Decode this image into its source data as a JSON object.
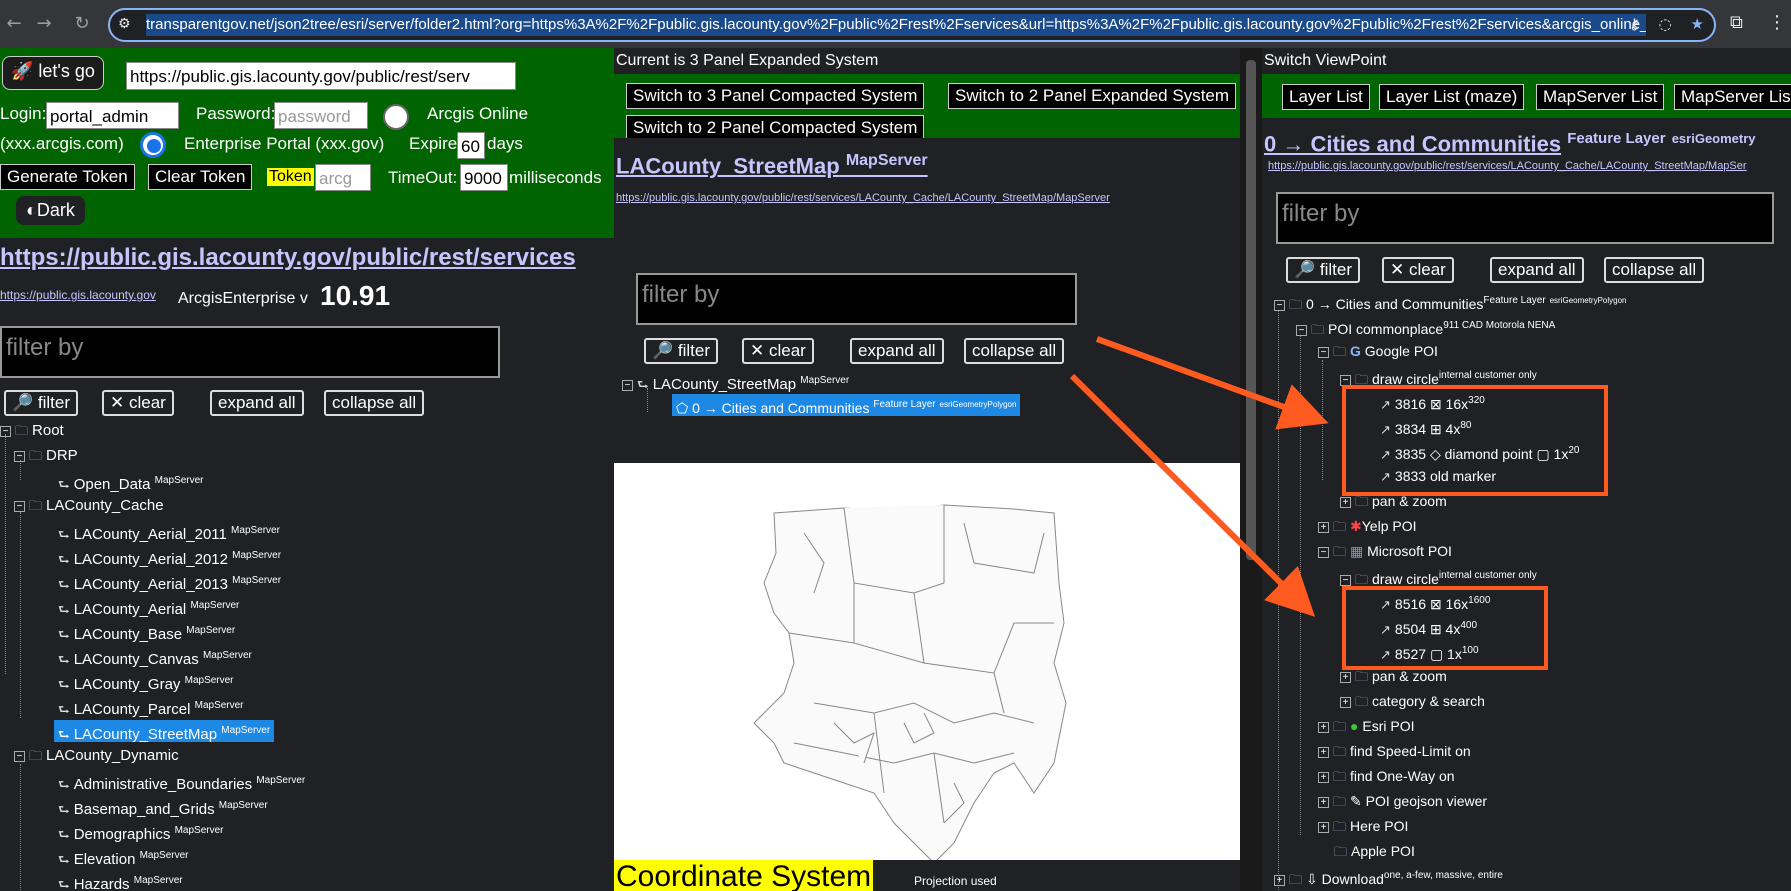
{
  "browser": {
    "url": "transparentgov.net/json2tree/esri/server/folder2.html?org=https%3A%2F%2Fpublic.gis.lacounty.gov%2Fpublic%2Frest%2Fservices&url=https%3A%2F%2Fpublic.gis.lacounty.gov%2Fpublic%2Frest%2Fservices&arcgis_online_token=&timeo"
  },
  "left": {
    "lets_go": "🚀 let's go",
    "url_value": "https://public.gis.lacounty.gov/public/rest/serv",
    "login_label": "Login:",
    "login_value": "portal_admin",
    "password_label": "Password:",
    "password_placeholder": "password",
    "arcgis_online_label": "Arcgis Online",
    "arcgis_online_sub": "(xxx.arcgis.com)",
    "enterprise_label": "Enterprise Portal (xxx.gov)",
    "expire_label": "Expire",
    "expire_value": "60",
    "days_label": "days",
    "generate_token": "Generate Token",
    "clear_token": "Clear Token",
    "token_label": "Token",
    "token_placeholder": "arcg",
    "timeout_label": "TimeOut:",
    "timeout_value": "9000",
    "ms_label": "milliseconds",
    "dark_label": "◐Dark",
    "services_link": "https://public.gis.lacounty.gov/public/rest/services",
    "host_link": "https://public.gis.lacounty.gov",
    "enterprise_text": "ArcgisEnterprise v",
    "version": "10.91",
    "filter_placeholder": "filter by",
    "filter_btn": "filter",
    "clear_btn": "clear",
    "expand_all": "expand all",
    "collapse_all": "collapse all",
    "tree": {
      "root": "Root",
      "drp": "DRP",
      "open_data": "Open_Data",
      "cache": "LACounty_Cache",
      "cache_items": [
        "LACounty_Aerial_2011",
        "LACounty_Aerial_2012",
        "LACounty_Aerial_2013",
        "LACounty_Aerial",
        "LACounty_Base",
        "LACounty_Canvas",
        "LACounty_Gray",
        "LACounty_Parcel",
        "LACounty_StreetMap"
      ],
      "dynamic": "LACounty_Dynamic",
      "dynamic_items": [
        "Administrative_Boundaries",
        "Basemap_and_Grids",
        "Demographics",
        "Elevation",
        "Hazards"
      ],
      "tag": "MapServer"
    }
  },
  "middle": {
    "header": "Current is 3 Panel Expanded System",
    "btn_3_compact": "Switch to 3 Panel Compacted System",
    "btn_2_expanded": "Switch to 2 Panel Expanded System",
    "btn_2_compact": "Switch to 2 Panel Compacted System",
    "title": "LACounty_StreetMap",
    "title_tag": "MapServer",
    "url": "https://public.gis.lacounty.gov/public/rest/services/LACounty_Cache/LACounty_StreetMap/MapServer",
    "filter_placeholder": "filter by",
    "filter_btn": "filter",
    "clear_btn": "clear",
    "expand_all": "expand all",
    "collapse_all": "collapse all",
    "tree_root": "LACounty_StreetMap",
    "tree_root_tag": "MapServer",
    "tree_layer": "0 → Cities and Communities",
    "tree_layer_tag": "Feature Layer",
    "tree_layer_geom": "esriGeometryPolygon",
    "coord_title": "Coordinate System",
    "coord_sub": "Projection used"
  },
  "right": {
    "header": "Switch ViewPoint",
    "btn_layer_list": "Layer List",
    "btn_layer_maze": "Layer List (maze)",
    "btn_mapserver_list": "MapServer List",
    "btn_mapserver_list2": "MapServer List",
    "title": "0 → Cities and Communities",
    "title_tag": "Feature Layer",
    "title_geom": "esriGeometry",
    "url": "https://public.gis.lacounty.gov/public/rest/services/LACounty_Cache/LACounty_StreetMap/MapSer",
    "filter_placeholder": "filter by",
    "filter_btn": "filter",
    "clear_btn": "clear",
    "expand_all": "expand all",
    "collapse_all": "collapse all",
    "tree": {
      "root": "0 → Cities and Communities",
      "root_tag": "Feature Layer",
      "root_geom": "esriGeometryPolygon",
      "poi": "POI commonplace",
      "poi_tag": "911 CAD Motorola NENA",
      "google": "Google POI",
      "draw_circle": "draw circle",
      "draw_circle_tag": "internal customer only",
      "g1": "3816 ⊠ 16x",
      "g1_sup": "320",
      "g2": "3834 ⊞ 4x",
      "g2_sup": "80",
      "g3": "3835 ◇ diamond point ▢ 1x",
      "g3_sup": "20",
      "g4": "3833 old marker",
      "pan_zoom": "pan & zoom",
      "yelp": "Yelp POI",
      "microsoft": "Microsoft POI",
      "m1": "8516 ⊠ 16x",
      "m1_sup": "1600",
      "m2": "8504 ⊞ 4x",
      "m2_sup": "400",
      "m3": "8527 ▢ 1x",
      "m3_sup": "100",
      "category_search": "category & search",
      "esri": "Esri POI",
      "speed": "find Speed-Limit on",
      "oneway": "find One-Way on",
      "geojson": "POI geojson viewer",
      "here": "Here POI",
      "apple": "Apple POI",
      "download": "Download",
      "download_tag": "one, a-few, massive, entire"
    }
  },
  "colors": {
    "green": "#006400",
    "accent": "#ff5a1f",
    "selection": "#1e88e5",
    "link": "#c6c6ff",
    "token_highlight": "#ffff00"
  }
}
